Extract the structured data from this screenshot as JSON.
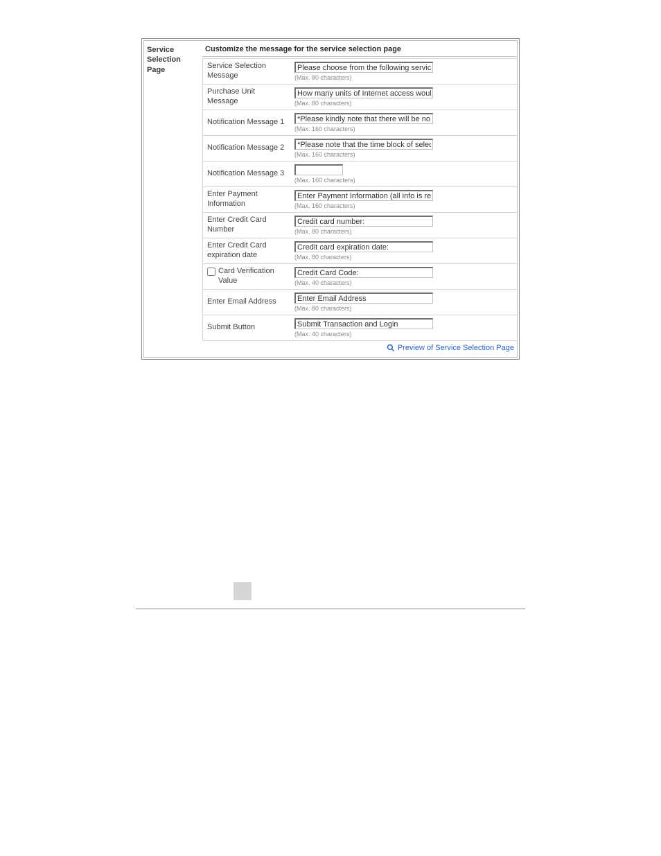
{
  "sectionTitle": "Service Selection Page",
  "sectionHeader": "Customize the message for the service selection page",
  "rows": {
    "svcSel": {
      "label": "Service Selection Message",
      "value": "Please choose from the following service selection",
      "hint": "(Max. 80 characters)"
    },
    "purchaseUnit": {
      "label": "Purchase Unit Message",
      "value": "How many units of Internet access would you like to",
      "hint": "(Max. 80 characters)"
    },
    "notif1": {
      "label": "Notification Message 1",
      "value": "*Please kindly note that there will be no refund once",
      "hint": "(Max. 160 characters)"
    },
    "notif2": {
      "label": "Notification Message 2",
      "value": "*Please note that the time block of selected service",
      "hint": "(Max. 160 characters)"
    },
    "notif3": {
      "label": "Notification Message 3",
      "value": "",
      "hint": "(Max. 160 characters)"
    },
    "enterPayment": {
      "label": "Enter Payment Information",
      "value": "Enter Payment Information (all info is required)",
      "hint": "(Max. 160 characters)"
    },
    "ccNumber": {
      "label": "Enter Credit Card Number",
      "value": "Credit card number:",
      "hint": "(Max. 80 characters)"
    },
    "ccExp": {
      "label": "Enter Credit Card expiration date",
      "value": "Credit card expiration date:",
      "hint": "(Max. 80 characters)"
    },
    "cvv": {
      "label": "Card Verification Value",
      "value": "Credit Card Code:",
      "hint": "(Max. 40 characters)"
    },
    "email": {
      "label": "Enter Email Address",
      "value": "Enter Email Address",
      "hint": "(Max. 80 characters)"
    },
    "submit": {
      "label": "Submit Button",
      "value": "Submit Transaction and Login",
      "hint": "(Max. 40 characters)"
    }
  },
  "previewLink": "Preview of Service Selection Page"
}
